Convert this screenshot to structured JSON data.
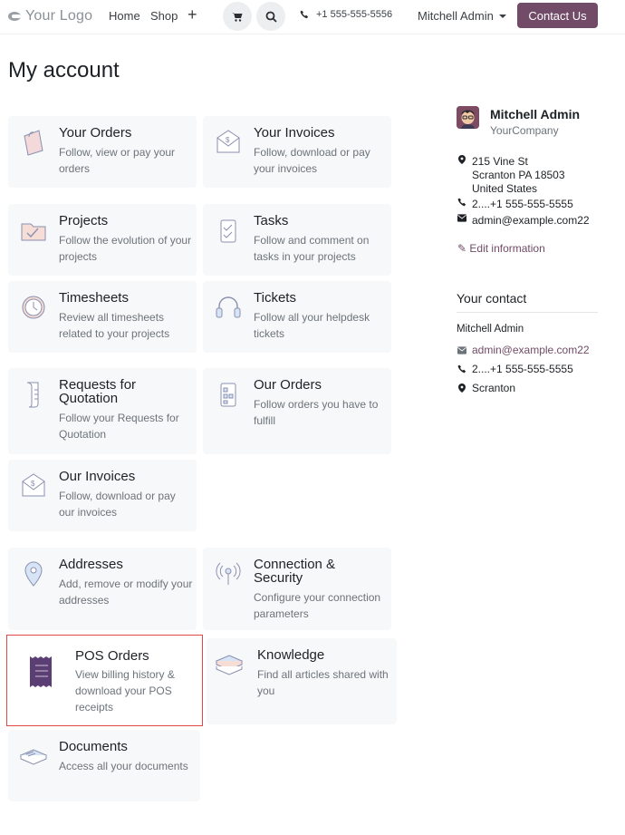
{
  "header": {
    "logo_text": "Your Logo",
    "nav": {
      "home": "Home",
      "shop": "Shop",
      "plus": "+"
    },
    "phone": "+1 555-555-5556",
    "user": "Mitchell Admin",
    "contact_button": "Contact Us"
  },
  "page_title": "My account",
  "cards": [
    {
      "title": "Your Orders",
      "desc": "Follow, view or pay your orders",
      "icon": "shopping-bag-icon"
    },
    {
      "title": "Your Invoices",
      "desc": "Follow, download or pay your invoices",
      "icon": "invoice-envelope-icon"
    },
    {
      "title": "Projects",
      "desc": "Follow the evolution of your projects",
      "icon": "folder-check-icon"
    },
    {
      "title": "Tasks",
      "desc": "Follow and comment on tasks in your projects",
      "icon": "clipboard-check-icon"
    },
    {
      "title": "Timesheets",
      "desc": "Review all timesheets related to your projects",
      "icon": "clock-icon"
    },
    {
      "title": "Tickets",
      "desc": "Follow all your helpdesk tickets",
      "icon": "headset-icon"
    },
    {
      "title": "Requests for Quotation",
      "desc": "Follow your Requests for Quotation",
      "icon": "scroll-icon"
    },
    {
      "title": "Our Orders",
      "desc": "Follow orders you have to fulfill",
      "icon": "checklist-icon"
    },
    {
      "title": "Our Invoices",
      "desc": "Follow, download or pay our invoices",
      "icon": "invoice-envelope-icon"
    },
    {
      "title": "Addresses",
      "desc": "Add, remove or modify your addresses",
      "icon": "map-pin-icon"
    },
    {
      "title": "Connection & Security",
      "desc": "Configure your connection parameters",
      "icon": "antenna-icon"
    },
    {
      "title": "POS Orders",
      "desc": "View billing history & download your POS receipts",
      "icon": "receipt-icon"
    },
    {
      "title": "Knowledge",
      "desc": "Find all articles shared with you",
      "icon": "books-icon"
    },
    {
      "title": "Documents",
      "desc": "Access all your documents",
      "icon": "documents-icon"
    }
  ],
  "sidebar": {
    "name": "Mitchell Admin",
    "company": "YourCompany",
    "address_line1": "215 Vine St",
    "address_line2": "Scranton PA 18503",
    "address_line3": "United States",
    "phone": "2....+1 555-555-5555",
    "email": "admin@example.com22",
    "edit_label": "Edit information",
    "your_contact": "Your contact",
    "contact_name": "Mitchell Admin",
    "contact_email": "admin@example.com22",
    "contact_phone": "2....+1 555-555-5555",
    "contact_city": "Scranton"
  },
  "colors": {
    "brand": "#714b67",
    "card_bg": "#f7f8f9",
    "highlight": "#e04848"
  }
}
